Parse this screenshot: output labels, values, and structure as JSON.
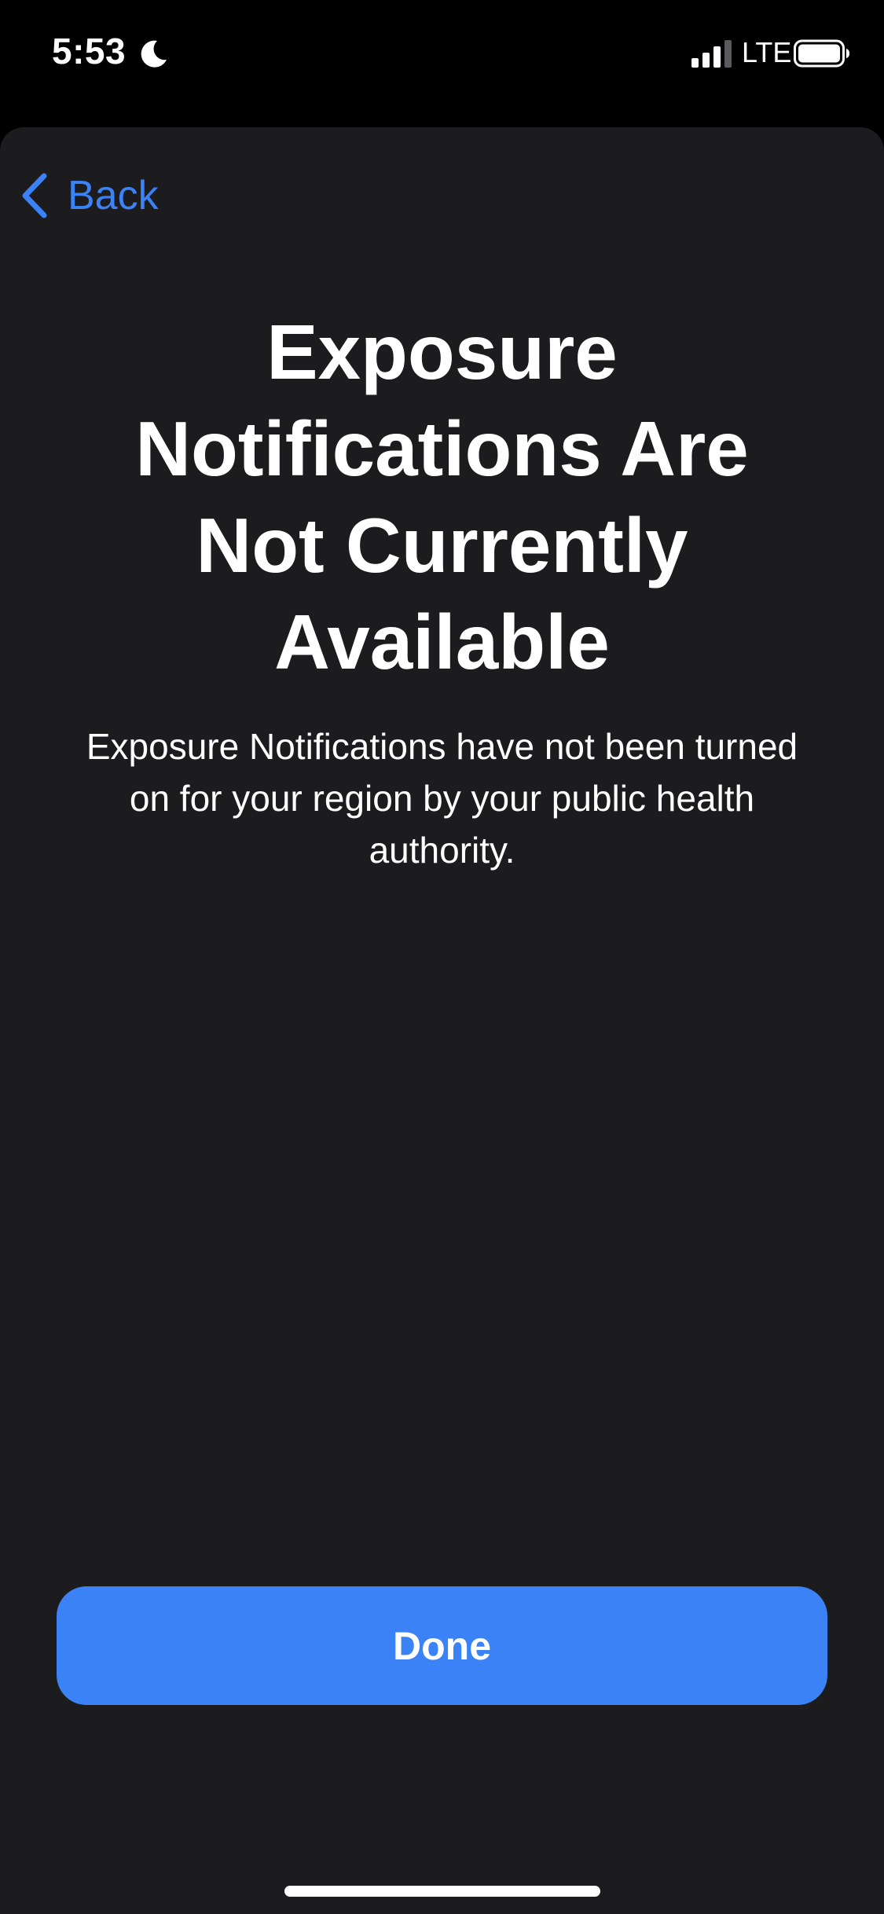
{
  "status_bar": {
    "time": "5:53",
    "focus_icon": "moon-icon",
    "signal_icon": "cellular-signal-icon",
    "network": "LTE",
    "battery_icon": "battery-icon"
  },
  "nav": {
    "back_label": "Back",
    "back_icon": "chevron-left-icon"
  },
  "content": {
    "title": "Exposure Notifications Are Not Currently Available",
    "body": "Exposure Notifications have not been turned on for your region by your public health authority."
  },
  "actions": {
    "done_label": "Done"
  },
  "colors": {
    "accent": "#3b82f6",
    "sheet_background": "#1c1c1e",
    "status_background": "#000000",
    "text": "#ffffff"
  }
}
